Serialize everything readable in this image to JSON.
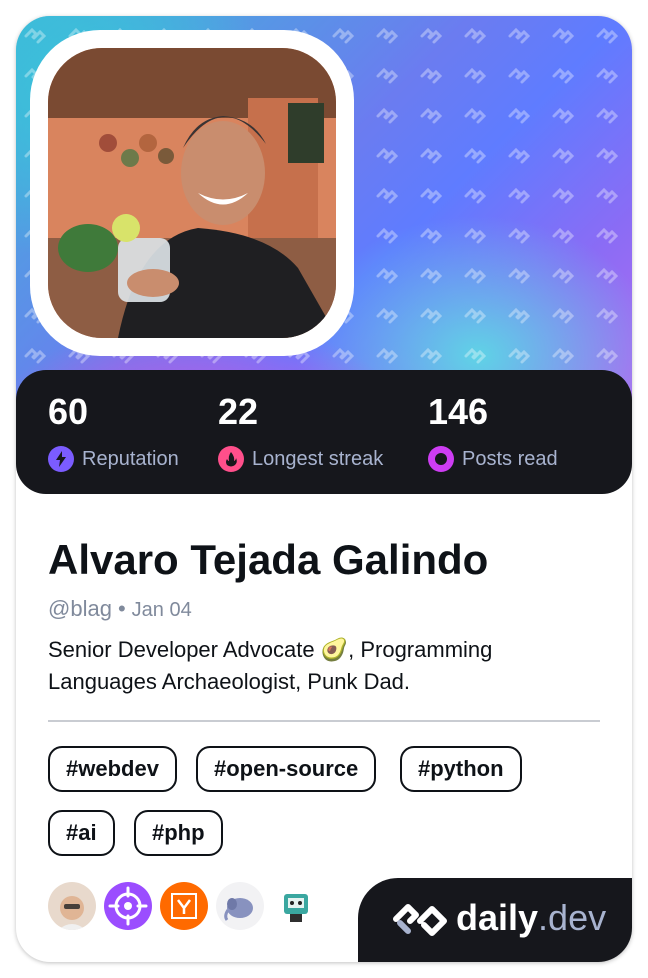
{
  "profile": {
    "name": "Alvaro Tejada Galindo",
    "handle": "@blag",
    "separator": "•",
    "joined": "Jan 04",
    "bio": "Senior Developer Advocate 🥑, Programming Languages Archaeologist, Punk Dad."
  },
  "stats": [
    {
      "value": "60",
      "label": "Reputation",
      "icon": "bolt-icon",
      "color": "#7b5cff"
    },
    {
      "value": "22",
      "label": "Longest streak",
      "icon": "flame-icon",
      "color": "#ff4f8b"
    },
    {
      "value": "146",
      "label": "Posts read",
      "icon": "ring-icon",
      "color": "#ce3df3"
    }
  ],
  "tags": [
    "#webdev",
    "#open-source",
    "#python",
    "#ai",
    "#php"
  ],
  "sources": [
    {
      "icon": "memoji-avatar-icon",
      "color": "#d9c7b6"
    },
    {
      "icon": "crosshair-icon",
      "color": "#9b4dff"
    },
    {
      "icon": "hacker-news-icon",
      "color": "#ff6a00"
    },
    {
      "icon": "php-elephant-icon",
      "color": "#8892bf"
    },
    {
      "icon": "robot-mascot-icon",
      "color": "#3aa7a0"
    }
  ],
  "brand": {
    "name": "daily",
    "suffix": ".dev"
  },
  "colors": {
    "card_dark": "#16171c",
    "text_primary": "#0e1217",
    "text_secondary": "#a8b3cf"
  }
}
